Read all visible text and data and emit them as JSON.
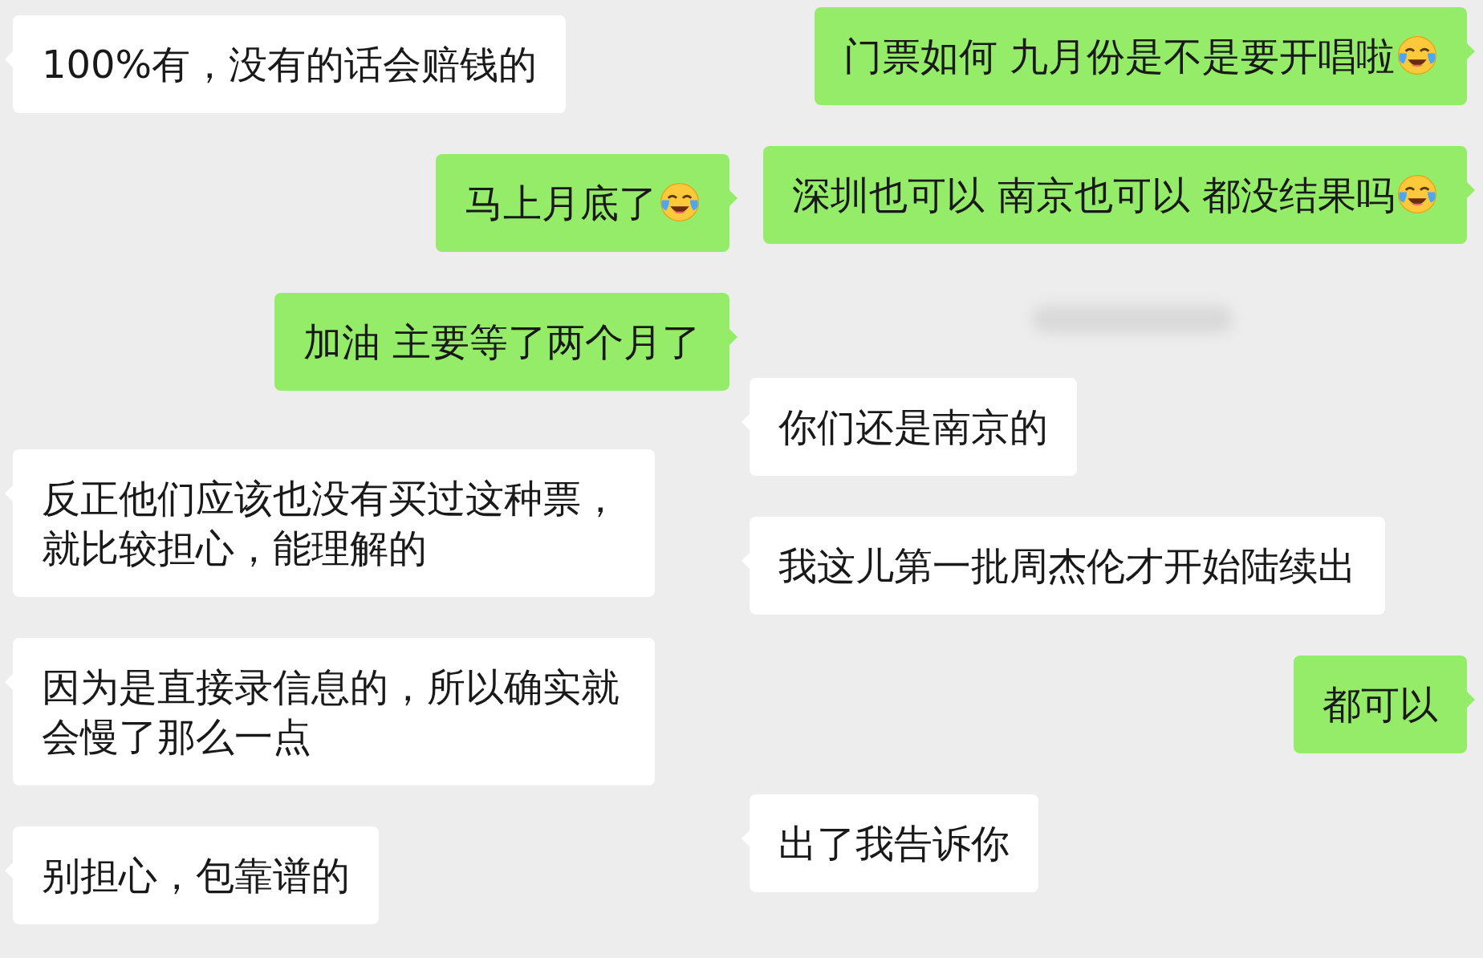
{
  "left_chat": {
    "messages": [
      {
        "kind": "received",
        "text": "100%有，没有的话会赔钱的",
        "emoji": false
      },
      {
        "kind": "sent",
        "text": "马上月底了",
        "emoji": true
      },
      {
        "kind": "sent",
        "text": "加油 主要等了两个月了",
        "emoji": false
      },
      {
        "kind": "received",
        "text": "反正他们应该也没有买过这种票，就比较担心，能理解的",
        "emoji": false
      },
      {
        "kind": "received",
        "text": "因为是直接录信息的，所以确实就会慢了那么一点",
        "emoji": false
      },
      {
        "kind": "received",
        "text": "别担心，包靠谱的",
        "emoji": false
      }
    ]
  },
  "right_chat": {
    "messages": [
      {
        "kind": "sent",
        "text": "门票如何 九月份是不是要开唱啦",
        "emoji": true
      },
      {
        "kind": "sent",
        "text": "深圳也可以 南京也可以 都没结果吗",
        "emoji": true
      },
      {
        "kind": "timestamp"
      },
      {
        "kind": "received",
        "text": "你们还是南京的",
        "emoji": false
      },
      {
        "kind": "received",
        "text": "我这儿第一批周杰伦才开始陆续出",
        "emoji": false
      },
      {
        "kind": "sent",
        "text": "都可以",
        "emoji": false
      },
      {
        "kind": "received",
        "text": "出了我告诉你",
        "emoji": false
      }
    ]
  }
}
